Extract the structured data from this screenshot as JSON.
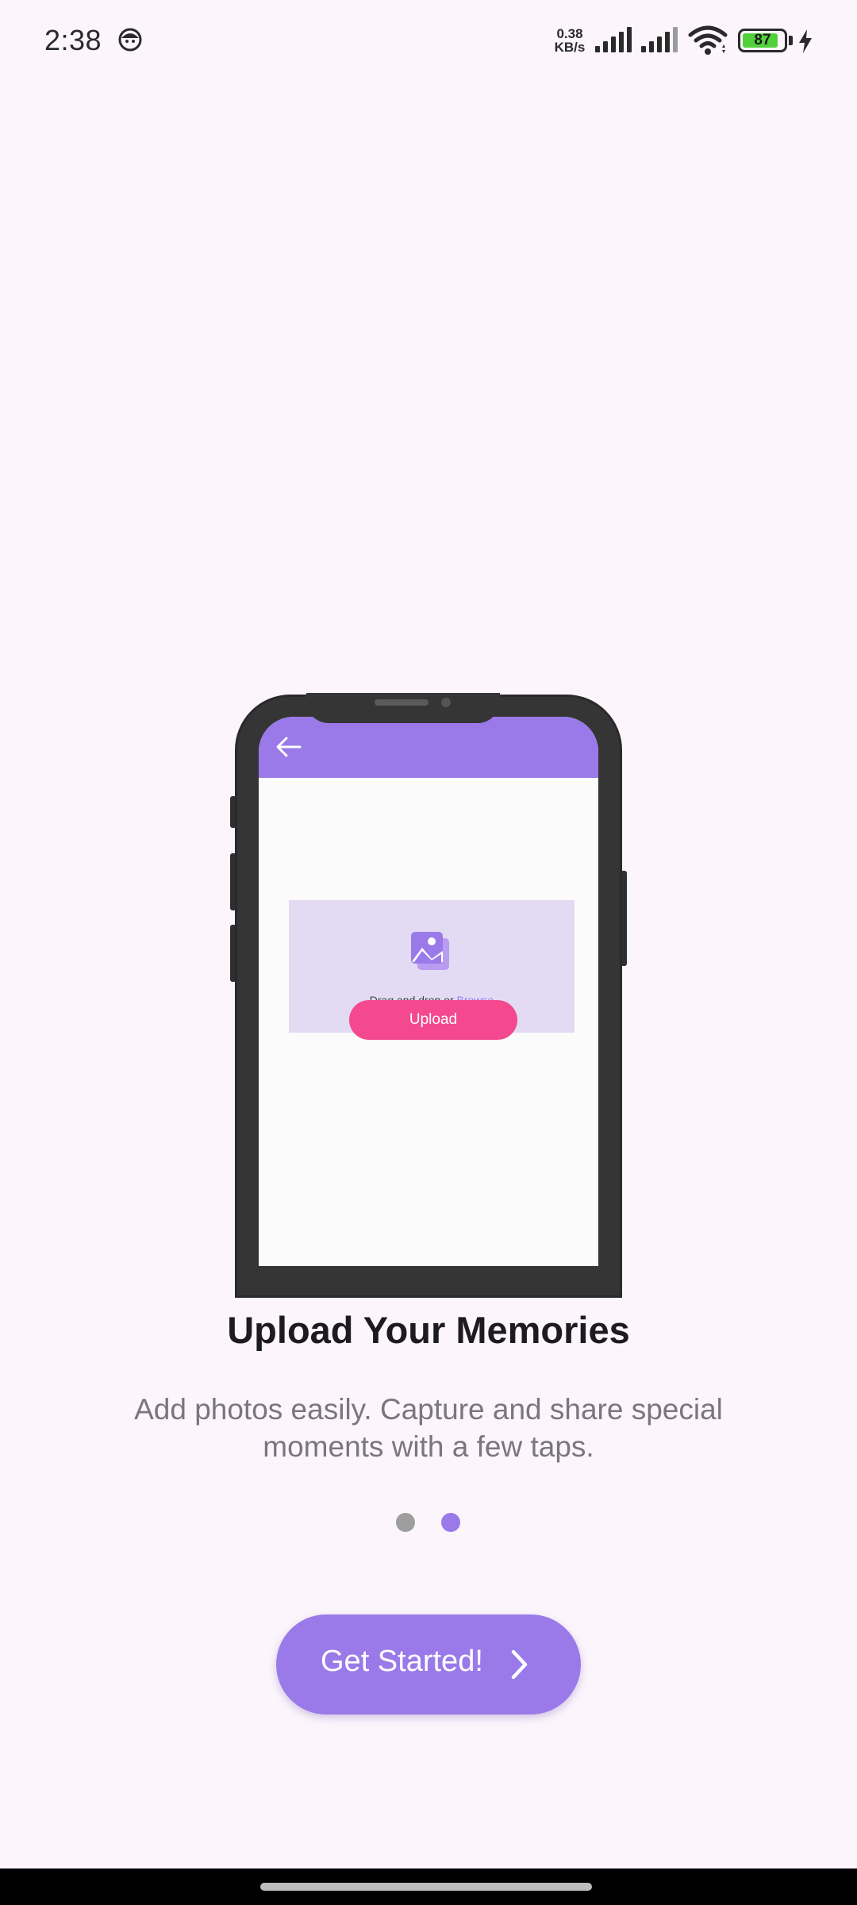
{
  "status_bar": {
    "time": "2:38",
    "net_speed_value": "0.38",
    "net_speed_unit": "KB/s",
    "battery_level": "87",
    "battery_fraction": 0.87,
    "icons": [
      "face-icon",
      "signal-icon",
      "signal-icon",
      "wifi-icon",
      "battery-icon",
      "charging-bolt-icon"
    ]
  },
  "illustration": {
    "dropzone_prefix": "Drag and drop or ",
    "dropzone_link": "Browse",
    "upload_button": "Upload",
    "icons": [
      "back-arrow-icon",
      "image-icon"
    ]
  },
  "onboarding": {
    "title": "Upload Your Memories",
    "subtitle": "Add photos easily. Capture and share special moments with a few taps.",
    "page_count": 2,
    "active_page": 2,
    "cta_label": "Get Started!",
    "cta_icon": "chevron-right-icon"
  },
  "colors": {
    "accent": "#9a7ae9",
    "pink": "#f4498f",
    "background": "#fcf5fc",
    "dot_inactive": "#9e9e9e",
    "dropzone": "#e2dbf3"
  }
}
